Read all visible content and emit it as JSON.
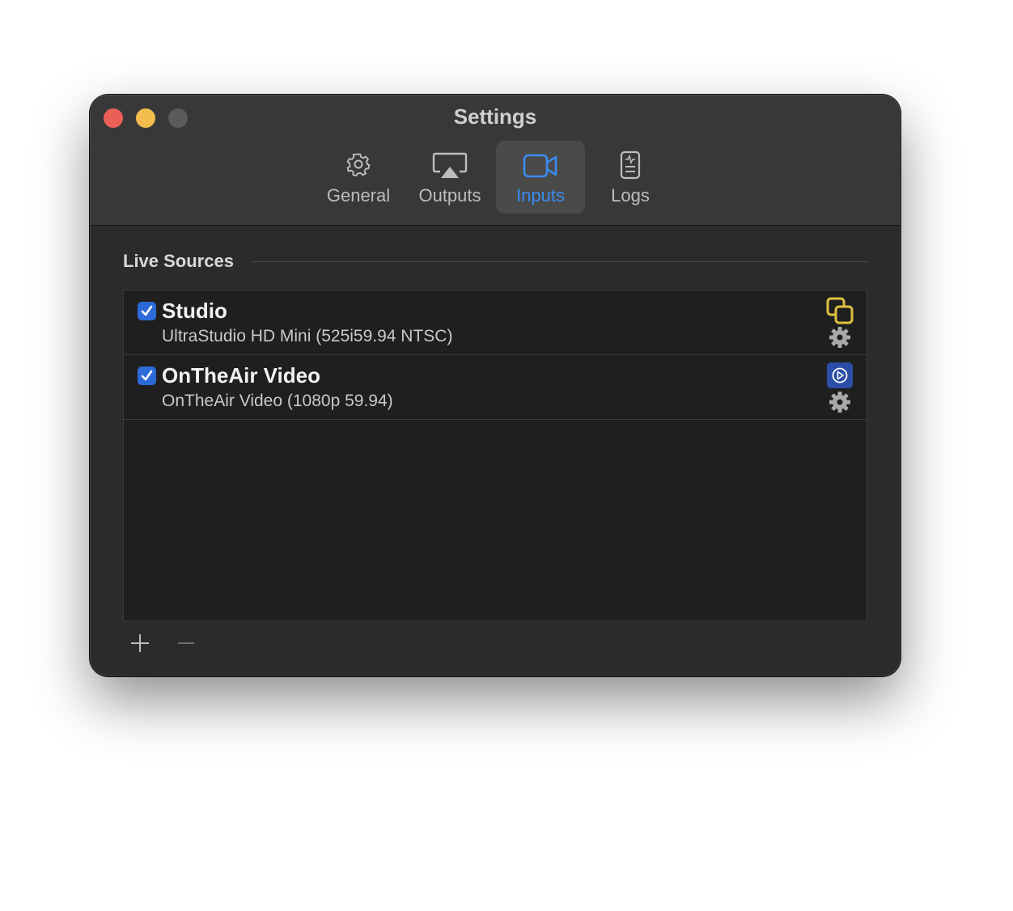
{
  "window": {
    "title": "Settings"
  },
  "toolbar": {
    "tabs": [
      {
        "label": "General",
        "icon": "gear-icon"
      },
      {
        "label": "Outputs",
        "icon": "airplay-icon"
      },
      {
        "label": "Inputs",
        "icon": "video-camera-icon",
        "selected": true
      },
      {
        "label": "Logs",
        "icon": "log-document-icon"
      }
    ]
  },
  "section": {
    "title": "Live Sources"
  },
  "sources": [
    {
      "name": "Studio",
      "detail": "UltraStudio HD Mini (525i59.94 NTSC)",
      "enabled": true,
      "badge_icon": "overlapping-squares-icon",
      "badge_color": "#e0c040"
    },
    {
      "name": "OnTheAir Video",
      "detail": "OnTheAir Video (1080p 59.94)",
      "enabled": true,
      "badge_icon": "play-circle-icon",
      "badge_color": "#2b4ea8"
    }
  ],
  "colors": {
    "accent": "#3b8cf0",
    "checkbox": "#2c6ad8",
    "close": "#ec5f57",
    "minimize": "#f4be4f"
  },
  "controls": {
    "add": "+",
    "remove": "−"
  }
}
